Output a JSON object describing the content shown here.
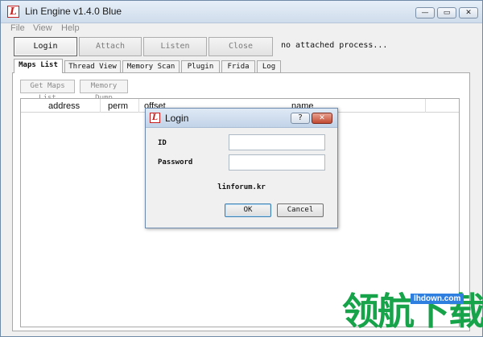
{
  "window": {
    "title": "Lin Engine v1.4.0 Blue",
    "controls": {
      "minimize": "—",
      "maximize": "▭",
      "close": "✕"
    }
  },
  "menu": [
    "File",
    "View",
    "Help"
  ],
  "toolbar": {
    "login": "Login",
    "attach": "Attach",
    "listen": "Listen",
    "close": "Close",
    "status": "no attached process..."
  },
  "tabs": [
    "Maps List",
    "Thread View",
    "Memory Scan",
    "Plugin",
    "Frida",
    "Log"
  ],
  "maps_panel": {
    "get_maps_list": "Get Maps List",
    "memory_dump": "Memory Dump",
    "columns": [
      "address",
      "perm",
      "offset",
      "name"
    ]
  },
  "login_dialog": {
    "title": "Login",
    "help": "?",
    "close": "✕",
    "id_label": "ID",
    "id_value": "",
    "password_label": "Password",
    "password_value": "",
    "site": "linforum.kr",
    "ok": "OK",
    "cancel": "Cancel"
  },
  "watermark": {
    "url": "lhdown.com",
    "text": "领航下载"
  },
  "colors": {
    "title_bar": "#cfdceb",
    "close_button": "#c24a32",
    "watermark_green": "#16a34a",
    "watermark_blue": "#2f7fe0"
  }
}
